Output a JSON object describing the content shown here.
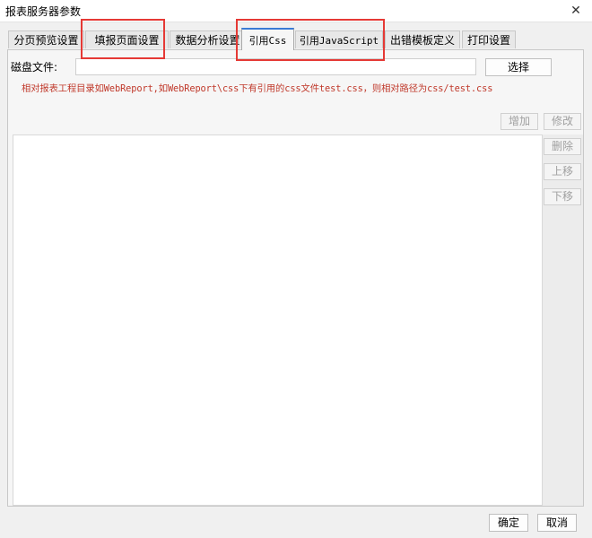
{
  "window": {
    "title": "报表服务器参数",
    "close_glyph": "✕"
  },
  "tabs": [
    {
      "label": "分页预览设置",
      "active": false
    },
    {
      "label": "填报页面设置",
      "active": false
    },
    {
      "label": "数据分析设置",
      "active": false
    },
    {
      "label": "引用Css",
      "active": true
    },
    {
      "label": "引用JavaScript",
      "active": false
    },
    {
      "label": "出错模板定义",
      "active": false
    },
    {
      "label": "打印设置",
      "active": false
    }
  ],
  "css_tab": {
    "disk_label": "磁盘文件:",
    "disk_value": "",
    "choose_label": "选择",
    "hint": "相对报表工程目录如WebReport,如WebReport\\css下有引用的css文件test.css，则相对路径为css/test.css",
    "hint_color": "#c0392b",
    "buttons": {
      "add": "增加",
      "edit": "修改",
      "delete": "删除",
      "move_up": "上移",
      "move_down": "下移"
    },
    "items": []
  },
  "footer": {
    "ok": "确定",
    "cancel": "取消"
  },
  "colors": {
    "highlight": "#e53935",
    "active_tab_accent": "#3a7bd5"
  }
}
